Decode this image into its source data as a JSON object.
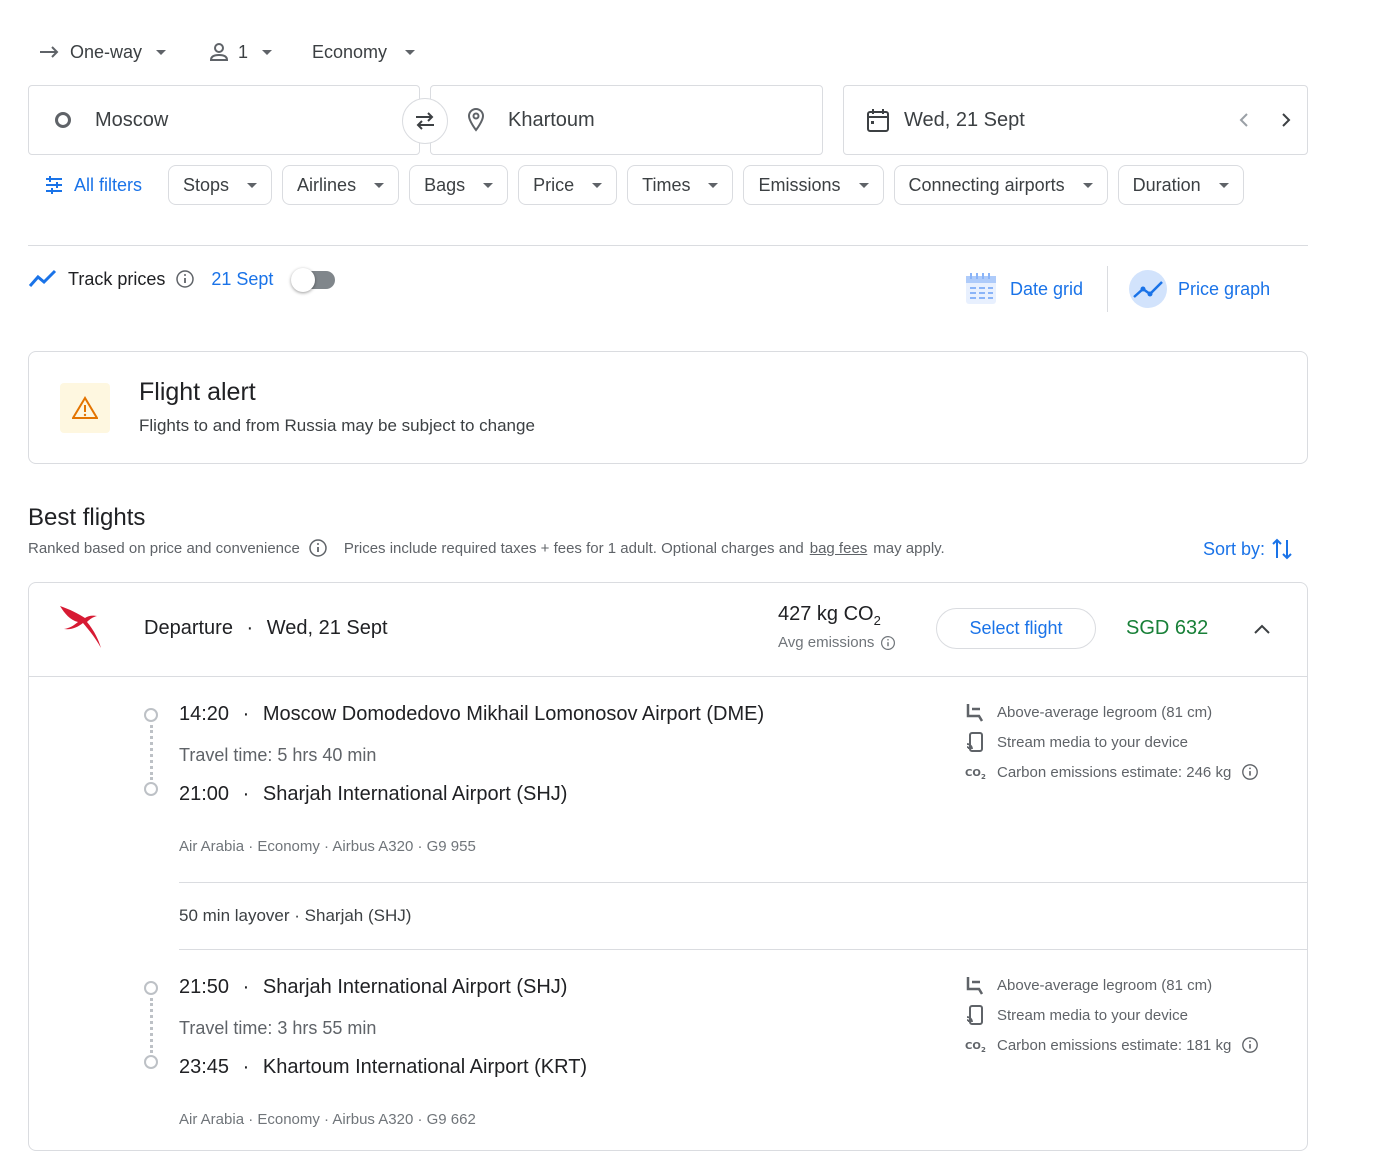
{
  "search": {
    "trip_type": "One-way",
    "passengers": "1",
    "cabin": "Economy",
    "origin": "Moscow",
    "destination": "Khartoum",
    "date": "Wed, 21 Sept"
  },
  "filters": {
    "all_filters": "All filters",
    "chips": [
      "Stops",
      "Airlines",
      "Bags",
      "Price",
      "Times",
      "Emissions",
      "Connecting airports",
      "Duration"
    ]
  },
  "track": {
    "label": "Track prices",
    "date": "21 Sept"
  },
  "views": {
    "date_grid": "Date grid",
    "price_graph": "Price graph"
  },
  "alert": {
    "title": "Flight alert",
    "message": "Flights to and from Russia may be subject to change"
  },
  "best": {
    "title": "Best flights",
    "ranked": "Ranked based on price and convenience",
    "prices_note": "Prices include required taxes + fees for 1 adult. Optional charges and",
    "bag_fees": "bag fees",
    "may_apply": "may apply.",
    "sort_by": "Sort by:"
  },
  "flight": {
    "departure_label": "Departure",
    "departure_date": "Wed, 21 Sept",
    "co2": "427 kg CO",
    "co2_sub": "2",
    "avg_emissions": "Avg emissions",
    "select": "Select flight",
    "price": "SGD 632",
    "legs": [
      {
        "depart": "14:20",
        "depart_airport": "Moscow Domodedovo Mikhail Lomonosov Airport (DME)",
        "travel_time": "Travel time: 5 hrs 40 min",
        "arrive": "21:00",
        "arrive_airport": "Sharjah International Airport (SHJ)",
        "meta": "Air Arabia · Economy · Airbus A320 · G9 955",
        "amenities": [
          "Above-average legroom (81 cm)",
          "Stream media to your device",
          "Carbon emissions estimate: 246 kg"
        ]
      },
      {
        "depart": "21:50",
        "depart_airport": "Sharjah International Airport (SHJ)",
        "travel_time": "Travel time: 3 hrs 55 min",
        "arrive": "23:45",
        "arrive_airport": "Khartoum International Airport (KRT)",
        "meta": "Air Arabia · Economy · Airbus A320 · G9 662",
        "amenities": [
          "Above-average legroom (81 cm)",
          "Stream media to your device",
          "Carbon emissions estimate: 181 kg"
        ]
      }
    ],
    "layover": "50 min layover · Sharjah (SHJ)"
  },
  "colors": {
    "accent": "#1a73e8",
    "price": "#188038",
    "border": "#dadce0",
    "warning": "#e37400"
  }
}
